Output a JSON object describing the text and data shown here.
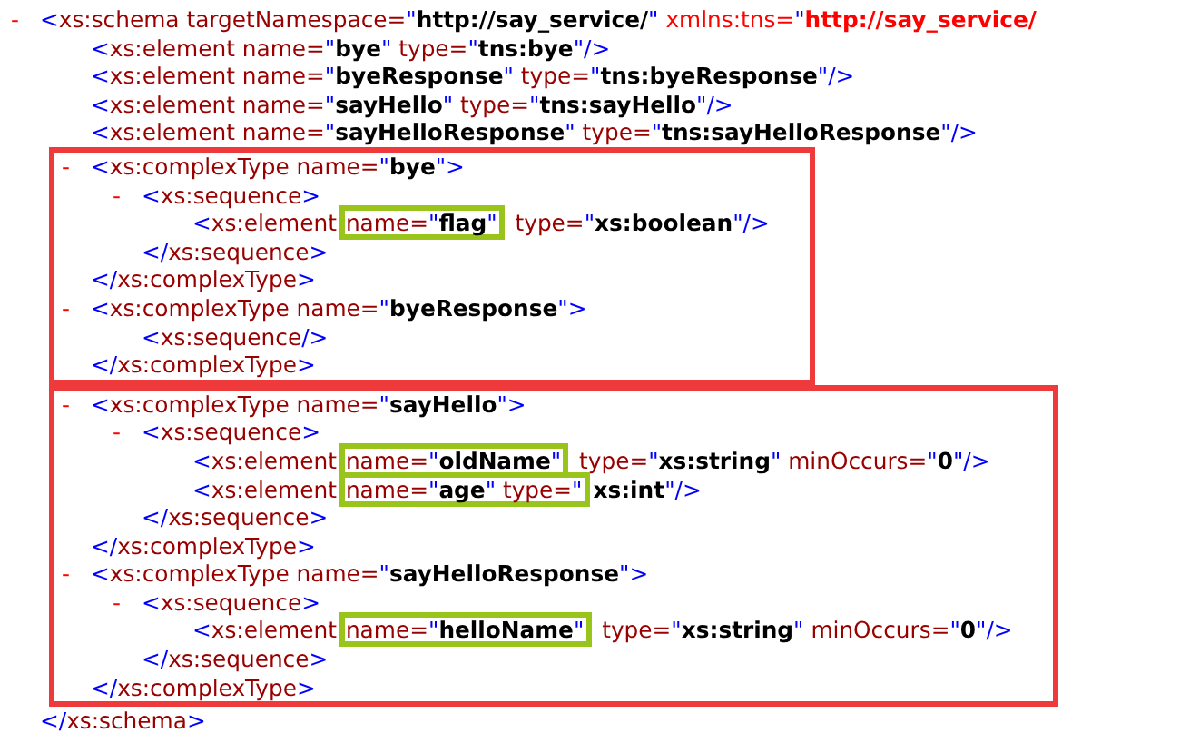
{
  "tree": {
    "toggle": "-",
    "open": [
      {
        "kind": "punct",
        "text": "<"
      },
      {
        "kind": "name",
        "text": "xs:schema"
      },
      {
        "kind": "name",
        "text": " targetNamespace="
      },
      {
        "kind": "punct",
        "text": "\""
      },
      {
        "kind": "value",
        "text": "http://say_service/"
      },
      {
        "kind": "punct",
        "text": "\""
      },
      {
        "kind": "ns_name",
        "text": " xmlns:tns="
      },
      {
        "kind": "punct",
        "text": "\""
      },
      {
        "kind": "ns_value",
        "text": "http://say_service/"
      }
    ],
    "children": [
      {
        "open": [
          {
            "kind": "punct",
            "text": "<"
          },
          {
            "kind": "name",
            "text": "xs:element"
          },
          {
            "kind": "name",
            "text": " name="
          },
          {
            "kind": "punct",
            "text": "\""
          },
          {
            "kind": "value",
            "text": "bye"
          },
          {
            "kind": "punct",
            "text": "\""
          },
          {
            "kind": "name",
            "text": " type="
          },
          {
            "kind": "punct",
            "text": "\""
          },
          {
            "kind": "value",
            "text": "tns:bye"
          },
          {
            "kind": "punct",
            "text": "\""
          },
          {
            "kind": "punct",
            "text": "/>"
          }
        ]
      },
      {
        "open": [
          {
            "kind": "punct",
            "text": "<"
          },
          {
            "kind": "name",
            "text": "xs:element"
          },
          {
            "kind": "name",
            "text": " name="
          },
          {
            "kind": "punct",
            "text": "\""
          },
          {
            "kind": "value",
            "text": "byeResponse"
          },
          {
            "kind": "punct",
            "text": "\""
          },
          {
            "kind": "name",
            "text": " type="
          },
          {
            "kind": "punct",
            "text": "\""
          },
          {
            "kind": "value",
            "text": "tns:byeResponse"
          },
          {
            "kind": "punct",
            "text": "\""
          },
          {
            "kind": "punct",
            "text": "/>"
          }
        ]
      },
      {
        "open": [
          {
            "kind": "punct",
            "text": "<"
          },
          {
            "kind": "name",
            "text": "xs:element"
          },
          {
            "kind": "name",
            "text": " name="
          },
          {
            "kind": "punct",
            "text": "\""
          },
          {
            "kind": "value",
            "text": "sayHello"
          },
          {
            "kind": "punct",
            "text": "\""
          },
          {
            "kind": "name",
            "text": " type="
          },
          {
            "kind": "punct",
            "text": "\""
          },
          {
            "kind": "value",
            "text": "tns:sayHello"
          },
          {
            "kind": "punct",
            "text": "\""
          },
          {
            "kind": "punct",
            "text": "/>"
          }
        ]
      },
      {
        "open": [
          {
            "kind": "punct",
            "text": "<"
          },
          {
            "kind": "name",
            "text": "xs:element"
          },
          {
            "kind": "name",
            "text": " name="
          },
          {
            "kind": "punct",
            "text": "\""
          },
          {
            "kind": "value",
            "text": "sayHelloResponse"
          },
          {
            "kind": "punct",
            "text": "\""
          },
          {
            "kind": "name",
            "text": " type="
          },
          {
            "kind": "punct",
            "text": "\""
          },
          {
            "kind": "value",
            "text": "tns:sayHelloResponse"
          },
          {
            "kind": "punct",
            "text": "\""
          },
          {
            "kind": "punct",
            "text": "/>"
          }
        ]
      },
      {
        "framed": true,
        "children": [
          {
            "toggle": "-",
            "open": [
              {
                "kind": "punct",
                "text": "<"
              },
              {
                "kind": "name",
                "text": "xs:complexType"
              },
              {
                "kind": "name",
                "text": " name="
              },
              {
                "kind": "punct",
                "text": "\""
              },
              {
                "kind": "value",
                "text": "bye"
              },
              {
                "kind": "punct",
                "text": "\">"
              }
            ],
            "children": [
              {
                "toggle": "-",
                "open": [
                  {
                    "kind": "punct",
                    "text": "<"
                  },
                  {
                    "kind": "name",
                    "text": "xs:sequence"
                  },
                  {
                    "kind": "punct",
                    "text": ">"
                  }
                ],
                "children": [
                  {
                    "open": [
                      {
                        "kind": "punct",
                        "text": "<"
                      },
                      {
                        "kind": "name",
                        "text": "xs:element"
                      },
                      {
                        "kind": "group",
                        "boxed": true,
                        "parts": [
                          {
                            "kind": "name",
                            "text": " name="
                          },
                          {
                            "kind": "punct",
                            "text": "\""
                          },
                          {
                            "kind": "value",
                            "text": "flag"
                          },
                          {
                            "kind": "punct",
                            "text": "\""
                          }
                        ]
                      },
                      {
                        "kind": "name",
                        "text": " type="
                      },
                      {
                        "kind": "punct",
                        "text": "\""
                      },
                      {
                        "kind": "value",
                        "text": "xs:boolean"
                      },
                      {
                        "kind": "punct",
                        "text": "\""
                      },
                      {
                        "kind": "punct",
                        "text": "/>"
                      }
                    ]
                  }
                ],
                "close": [
                  {
                    "kind": "punct",
                    "text": "</"
                  },
                  {
                    "kind": "name",
                    "text": "xs:sequence"
                  },
                  {
                    "kind": "punct",
                    "text": ">"
                  }
                ]
              }
            ],
            "close": [
              {
                "kind": "punct",
                "text": "</"
              },
              {
                "kind": "name",
                "text": "xs:complexType"
              },
              {
                "kind": "punct",
                "text": ">"
              }
            ]
          },
          {
            "toggle": "-",
            "open": [
              {
                "kind": "punct",
                "text": "<"
              },
              {
                "kind": "name",
                "text": "xs:complexType"
              },
              {
                "kind": "name",
                "text": " name="
              },
              {
                "kind": "punct",
                "text": "\""
              },
              {
                "kind": "value",
                "text": "byeResponse"
              },
              {
                "kind": "punct",
                "text": "\">"
              }
            ],
            "children": [
              {
                "open": [
                  {
                    "kind": "punct",
                    "text": "<"
                  },
                  {
                    "kind": "name",
                    "text": "xs:sequence"
                  },
                  {
                    "kind": "punct",
                    "text": "/>"
                  }
                ]
              }
            ],
            "close": [
              {
                "kind": "punct",
                "text": "</"
              },
              {
                "kind": "name",
                "text": "xs:complexType"
              },
              {
                "kind": "punct",
                "text": ">"
              }
            ]
          }
        ]
      },
      {
        "framed": true,
        "children": [
          {
            "toggle": "-",
            "open": [
              {
                "kind": "punct",
                "text": "<"
              },
              {
                "kind": "name",
                "text": "xs:complexType"
              },
              {
                "kind": "name",
                "text": " name="
              },
              {
                "kind": "punct",
                "text": "\""
              },
              {
                "kind": "value",
                "text": "sayHello"
              },
              {
                "kind": "punct",
                "text": "\">"
              }
            ],
            "children": [
              {
                "toggle": "-",
                "open": [
                  {
                    "kind": "punct",
                    "text": "<"
                  },
                  {
                    "kind": "name",
                    "text": "xs:sequence"
                  },
                  {
                    "kind": "punct",
                    "text": ">"
                  }
                ],
                "children": [
                  {
                    "open": [
                      {
                        "kind": "punct",
                        "text": "<"
                      },
                      {
                        "kind": "name",
                        "text": "xs:element"
                      },
                      {
                        "kind": "group",
                        "boxed": true,
                        "parts": [
                          {
                            "kind": "name",
                            "text": " name="
                          },
                          {
                            "kind": "punct",
                            "text": "\""
                          },
                          {
                            "kind": "value",
                            "text": "oldName"
                          },
                          {
                            "kind": "punct",
                            "text": "\""
                          }
                        ]
                      },
                      {
                        "kind": "name",
                        "text": " type="
                      },
                      {
                        "kind": "punct",
                        "text": "\""
                      },
                      {
                        "kind": "value",
                        "text": "xs:string"
                      },
                      {
                        "kind": "punct",
                        "text": "\""
                      },
                      {
                        "kind": "name",
                        "text": " minOccurs="
                      },
                      {
                        "kind": "punct",
                        "text": "\""
                      },
                      {
                        "kind": "value",
                        "text": "0"
                      },
                      {
                        "kind": "punct",
                        "text": "\""
                      },
                      {
                        "kind": "punct",
                        "text": "/>"
                      }
                    ]
                  },
                  {
                    "open": [
                      {
                        "kind": "punct",
                        "text": "<"
                      },
                      {
                        "kind": "name",
                        "text": "xs:element"
                      },
                      {
                        "kind": "group",
                        "boxed": true,
                        "parts": [
                          {
                            "kind": "name",
                            "text": " name="
                          },
                          {
                            "kind": "punct",
                            "text": "\""
                          },
                          {
                            "kind": "value",
                            "text": "age"
                          },
                          {
                            "kind": "punct",
                            "text": "\""
                          },
                          {
                            "kind": "name",
                            "text": " type="
                          },
                          {
                            "kind": "punct",
                            "text": "\""
                          }
                        ]
                      },
                      {
                        "kind": "value",
                        "text": "xs:int"
                      },
                      {
                        "kind": "punct",
                        "text": "\""
                      },
                      {
                        "kind": "punct",
                        "text": "/>"
                      }
                    ]
                  }
                ],
                "close": [
                  {
                    "kind": "punct",
                    "text": "</"
                  },
                  {
                    "kind": "name",
                    "text": "xs:sequence"
                  },
                  {
                    "kind": "punct",
                    "text": ">"
                  }
                ]
              }
            ],
            "close": [
              {
                "kind": "punct",
                "text": "</"
              },
              {
                "kind": "name",
                "text": "xs:complexType"
              },
              {
                "kind": "punct",
                "text": ">"
              }
            ]
          },
          {
            "toggle": "-",
            "open": [
              {
                "kind": "punct",
                "text": "<"
              },
              {
                "kind": "name",
                "text": "xs:complexType"
              },
              {
                "kind": "name",
                "text": " name="
              },
              {
                "kind": "punct",
                "text": "\""
              },
              {
                "kind": "value",
                "text": "sayHelloResponse"
              },
              {
                "kind": "punct",
                "text": "\">"
              }
            ],
            "children": [
              {
                "toggle": "-",
                "open": [
                  {
                    "kind": "punct",
                    "text": "<"
                  },
                  {
                    "kind": "name",
                    "text": "xs:sequence"
                  },
                  {
                    "kind": "punct",
                    "text": ">"
                  }
                ],
                "children": [
                  {
                    "open": [
                      {
                        "kind": "punct",
                        "text": "<"
                      },
                      {
                        "kind": "name",
                        "text": "xs:element"
                      },
                      {
                        "kind": "group",
                        "boxed": true,
                        "parts": [
                          {
                            "kind": "name",
                            "text": " name="
                          },
                          {
                            "kind": "punct",
                            "text": "\""
                          },
                          {
                            "kind": "value",
                            "text": "helloName"
                          },
                          {
                            "kind": "punct",
                            "text": "\""
                          }
                        ]
                      },
                      {
                        "kind": "name",
                        "text": " type="
                      },
                      {
                        "kind": "punct",
                        "text": "\""
                      },
                      {
                        "kind": "value",
                        "text": "xs:string"
                      },
                      {
                        "kind": "punct",
                        "text": "\""
                      },
                      {
                        "kind": "name",
                        "text": " minOccurs="
                      },
                      {
                        "kind": "punct",
                        "text": "\""
                      },
                      {
                        "kind": "value",
                        "text": "0"
                      },
                      {
                        "kind": "punct",
                        "text": "\""
                      },
                      {
                        "kind": "punct",
                        "text": "/>"
                      }
                    ]
                  }
                ],
                "close": [
                  {
                    "kind": "punct",
                    "text": "</"
                  },
                  {
                    "kind": "name",
                    "text": "xs:sequence"
                  },
                  {
                    "kind": "punct",
                    "text": ">"
                  }
                ]
              }
            ],
            "close": [
              {
                "kind": "punct",
                "text": "</"
              },
              {
                "kind": "name",
                "text": "xs:complexType"
              },
              {
                "kind": "punct",
                "text": ">"
              }
            ]
          }
        ]
      }
    ],
    "close": [
      {
        "kind": "punct",
        "text": "</"
      },
      {
        "kind": "name",
        "text": "xs:schema"
      },
      {
        "kind": "punct",
        "text": ">"
      }
    ]
  }
}
